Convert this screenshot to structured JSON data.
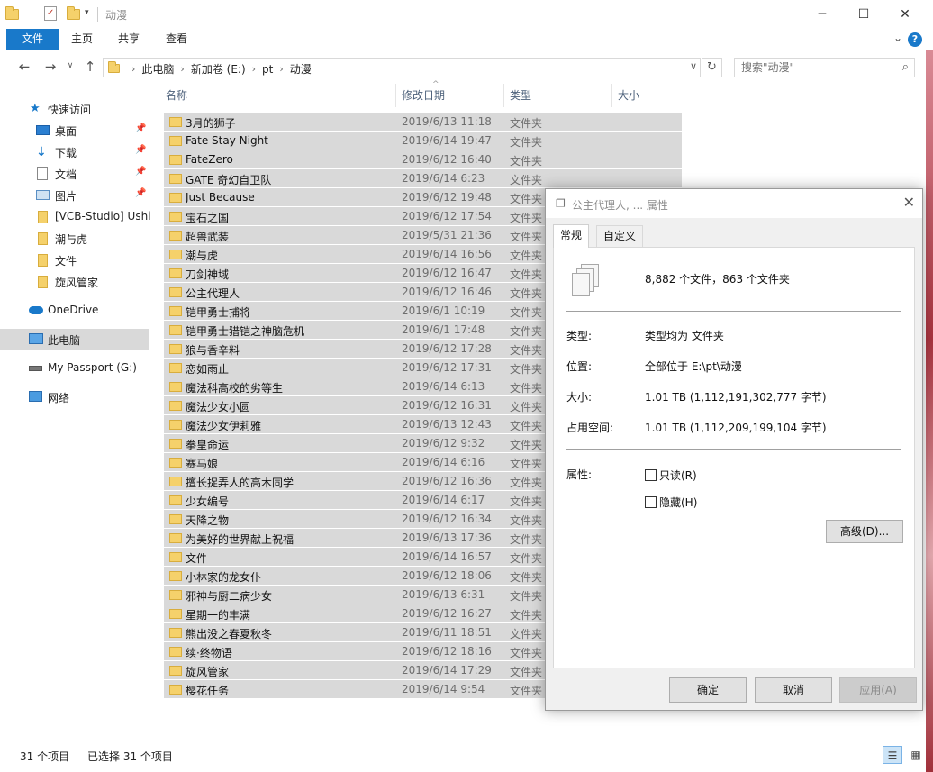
{
  "window": {
    "title": "动漫",
    "minimize": "─",
    "maximize": "☐",
    "close": "✕"
  },
  "ribbon": {
    "tabs": [
      "文件",
      "主页",
      "共享",
      "查看"
    ],
    "help": "?",
    "expand": "⌄"
  },
  "address": {
    "crumbs": [
      "此电脑",
      "新加卷 (E:)",
      "pt",
      "动漫"
    ],
    "search_placeholder": "搜索\"动漫\""
  },
  "nav": {
    "items": [
      {
        "label": "快速访问",
        "icon": "star-icon"
      },
      {
        "label": "桌面",
        "icon": "desktop-icon"
      },
      {
        "label": "下载",
        "icon": "download-icon"
      },
      {
        "label": "文档",
        "icon": "document-icon"
      },
      {
        "label": "图片",
        "icon": "picture-icon"
      },
      {
        "label": "[VCB-Studio] Ushi",
        "icon": "folder-icon"
      },
      {
        "label": "潮与虎",
        "icon": "folder-icon"
      },
      {
        "label": "文件",
        "icon": "folder-icon"
      },
      {
        "label": "旋风管家",
        "icon": "folder-icon"
      },
      {
        "label": "OneDrive",
        "icon": "cloud-icon"
      },
      {
        "label": "此电脑",
        "icon": "computer-icon"
      },
      {
        "label": "My Passport (G:)",
        "icon": "drive-icon"
      },
      {
        "label": "网络",
        "icon": "network-icon"
      }
    ]
  },
  "columns": {
    "name": "名称",
    "date": "修改日期",
    "type": "类型",
    "size": "大小"
  },
  "files": [
    {
      "name": "3月的狮子",
      "date": "2019/6/13 11:18",
      "type": "文件夹"
    },
    {
      "name": "Fate Stay Night",
      "date": "2019/6/14 19:47",
      "type": "文件夹"
    },
    {
      "name": "FateZero",
      "date": "2019/6/12 16:40",
      "type": "文件夹"
    },
    {
      "name": "GATE 奇幻自卫队",
      "date": "2019/6/14 6:23",
      "type": "文件夹"
    },
    {
      "name": "Just Because",
      "date": "2019/6/12 19:48",
      "type": "文件夹"
    },
    {
      "name": "宝石之国",
      "date": "2019/6/12 17:54",
      "type": "文件夹"
    },
    {
      "name": "超兽武装",
      "date": "2019/5/31 21:36",
      "type": "文件夹"
    },
    {
      "name": "潮与虎",
      "date": "2019/6/14 16:56",
      "type": "文件夹"
    },
    {
      "name": "刀剑神域",
      "date": "2019/6/12 16:47",
      "type": "文件夹"
    },
    {
      "name": "公主代理人",
      "date": "2019/6/12 16:46",
      "type": "文件夹"
    },
    {
      "name": "铠甲勇士捕将",
      "date": "2019/6/1 10:19",
      "type": "文件夹"
    },
    {
      "name": "铠甲勇士猎铠之神脑危机",
      "date": "2019/6/1 17:48",
      "type": "文件夹"
    },
    {
      "name": "狼与香辛料",
      "date": "2019/6/12 17:28",
      "type": "文件夹"
    },
    {
      "name": "恋如雨止",
      "date": "2019/6/12 17:31",
      "type": "文件夹"
    },
    {
      "name": "魔法科高校的劣等生",
      "date": "2019/6/14 6:13",
      "type": "文件夹"
    },
    {
      "name": "魔法少女小圆",
      "date": "2019/6/12 16:31",
      "type": "文件夹"
    },
    {
      "name": "魔法少女伊莉雅",
      "date": "2019/6/13 12:43",
      "type": "文件夹"
    },
    {
      "name": "拳皇命运",
      "date": "2019/6/12 9:32",
      "type": "文件夹"
    },
    {
      "name": "赛马娘",
      "date": "2019/6/14 6:16",
      "type": "文件夹"
    },
    {
      "name": "擅长捉弄人的高木同学",
      "date": "2019/6/12 16:36",
      "type": "文件夹"
    },
    {
      "name": "少女编号",
      "date": "2019/6/14 6:17",
      "type": "文件夹"
    },
    {
      "name": "天降之物",
      "date": "2019/6/12 16:34",
      "type": "文件夹"
    },
    {
      "name": "为美好的世界献上祝福",
      "date": "2019/6/13 17:36",
      "type": "文件夹"
    },
    {
      "name": "文件",
      "date": "2019/6/14 16:57",
      "type": "文件夹"
    },
    {
      "name": "小林家的龙女仆",
      "date": "2019/6/12 18:06",
      "type": "文件夹"
    },
    {
      "name": "邪神与厨二病少女",
      "date": "2019/6/13 6:31",
      "type": "文件夹"
    },
    {
      "name": "星期一的丰满",
      "date": "2019/6/12 16:27",
      "type": "文件夹"
    },
    {
      "name": "熊出没之春夏秋冬",
      "date": "2019/6/11 18:51",
      "type": "文件夹"
    },
    {
      "name": "续·终物语",
      "date": "2019/6/12 18:16",
      "type": "文件夹"
    },
    {
      "name": "旋风管家",
      "date": "2019/6/14 17:29",
      "type": "文件夹"
    },
    {
      "name": "樱花任务",
      "date": "2019/6/14 9:54",
      "type": "文件夹"
    }
  ],
  "status": {
    "count": "31 个项目",
    "selected": "已选择 31 个项目"
  },
  "dialog": {
    "title": "公主代理人, ... 属性",
    "tabs": {
      "general": "常规",
      "custom": "自定义"
    },
    "summary": "8,882 个文件，863 个文件夹",
    "type_label": "类型:",
    "type_value": "类型均为 文件夹",
    "location_label": "位置:",
    "location_value": "全部位于 E:\\pt\\动漫",
    "size_label": "大小:",
    "size_value": "1.01 TB (1,112,191,302,777 字节)",
    "disk_label": "占用空间:",
    "disk_value": "1.01 TB (1,112,209,199,104 字节)",
    "attributes_label": "属性:",
    "readonly": "只读(R)",
    "hidden": "隐藏(H)",
    "advanced": "高级(D)...",
    "ok": "确定",
    "cancel": "取消",
    "apply": "应用(A)"
  }
}
